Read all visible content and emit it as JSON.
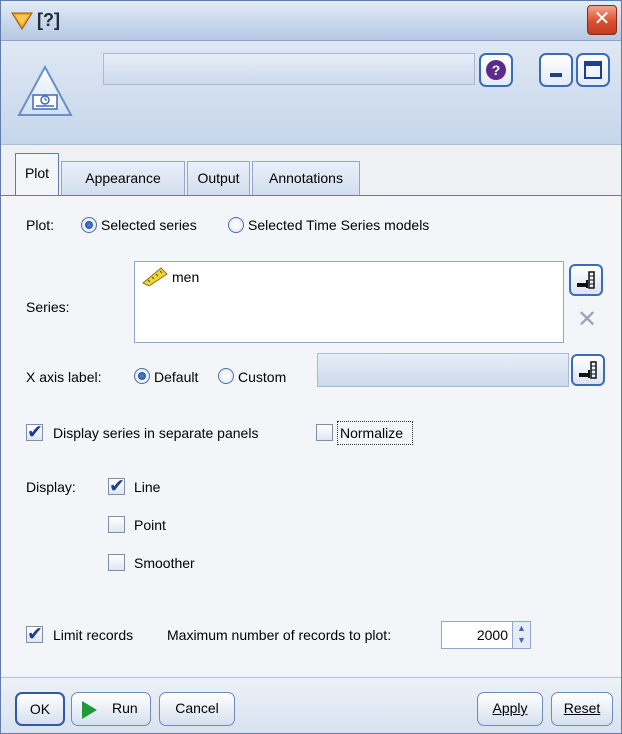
{
  "window": {
    "title": "[?]"
  },
  "header": {
    "help_icon": "question-circle-icon",
    "minimize_icon": "minimize-icon",
    "maximize_icon": "maximize-icon",
    "close_icon": "close-x-icon"
  },
  "tabs": [
    {
      "label": "Plot",
      "active": true
    },
    {
      "label": "Appearance",
      "active": false
    },
    {
      "label": "Output",
      "active": false
    },
    {
      "label": "Annotations",
      "active": false
    }
  ],
  "plot": {
    "label": "Plot:",
    "options": [
      {
        "label": "Selected series",
        "selected": true
      },
      {
        "label": "Selected Time Series models",
        "selected": false
      }
    ]
  },
  "series": {
    "label": "Series:",
    "items": [
      {
        "name": "men",
        "icon": "continuous-field-ruler-icon"
      }
    ]
  },
  "x_axis": {
    "label": "X axis label:",
    "options": [
      {
        "label": "Default",
        "selected": true
      },
      {
        "label": "Custom",
        "selected": false
      }
    ],
    "custom_value": ""
  },
  "separate_panels": {
    "label": "Display series in separate panels",
    "checked": true
  },
  "normalize": {
    "label": "Normalize",
    "checked": false
  },
  "display": {
    "label": "Display:",
    "options": [
      {
        "label": "Line",
        "checked": true
      },
      {
        "label": "Point",
        "checked": false
      },
      {
        "label": "Smoother",
        "checked": false
      }
    ]
  },
  "limit": {
    "label": "Limit records",
    "checked": true,
    "max_label": "Maximum number of records to plot:",
    "max_value": "2000"
  },
  "buttons": {
    "ok": "OK",
    "run": "Run",
    "cancel": "Cancel",
    "apply": "Apply",
    "reset": "Reset"
  }
}
